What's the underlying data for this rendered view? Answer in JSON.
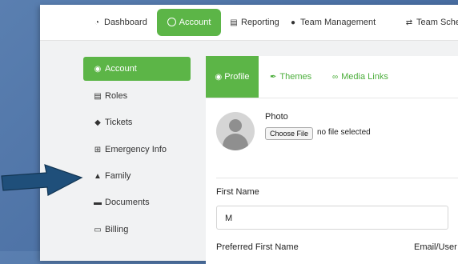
{
  "topnav": {
    "items": [
      {
        "label": "Dashboard",
        "icon": "dashboard-icon"
      },
      {
        "label": "Account",
        "icon": "user-circle-icon",
        "active": true
      },
      {
        "label": "Reporting",
        "icon": "report-icon"
      },
      {
        "label": "Team Management",
        "icon": "team-icon"
      },
      {
        "label": "Team Sche",
        "icon": "exchange-icon"
      }
    ]
  },
  "sidebar": {
    "items": [
      {
        "label": "Account",
        "icon": "user-circle-icon",
        "active": true
      },
      {
        "label": "Roles",
        "icon": "id-card-icon"
      },
      {
        "label": "Tickets",
        "icon": "ticket-icon"
      },
      {
        "label": "Emergency Info",
        "icon": "plus-square-icon"
      },
      {
        "label": "Family",
        "icon": "sitemap-icon"
      },
      {
        "label": "Documents",
        "icon": "folder-icon"
      },
      {
        "label": "Billing",
        "icon": "credit-card-icon"
      }
    ]
  },
  "tabs": [
    {
      "label": "Profile",
      "icon": "user-circle-icon",
      "active": true
    },
    {
      "label": "Themes",
      "icon": "brush-icon"
    },
    {
      "label": "Media Links",
      "icon": "link-icon"
    }
  ],
  "profile": {
    "photo_label": "Photo",
    "choose_file_label": "Choose File",
    "file_status": "no file selected",
    "first_name_label": "First Name",
    "first_name_value": "M",
    "preferred_first_name_label": "Preferred First Name",
    "email_label": "Email/User"
  },
  "colors": {
    "accent": "#5cb547",
    "annotation_arrow": "#1f4f7a"
  }
}
